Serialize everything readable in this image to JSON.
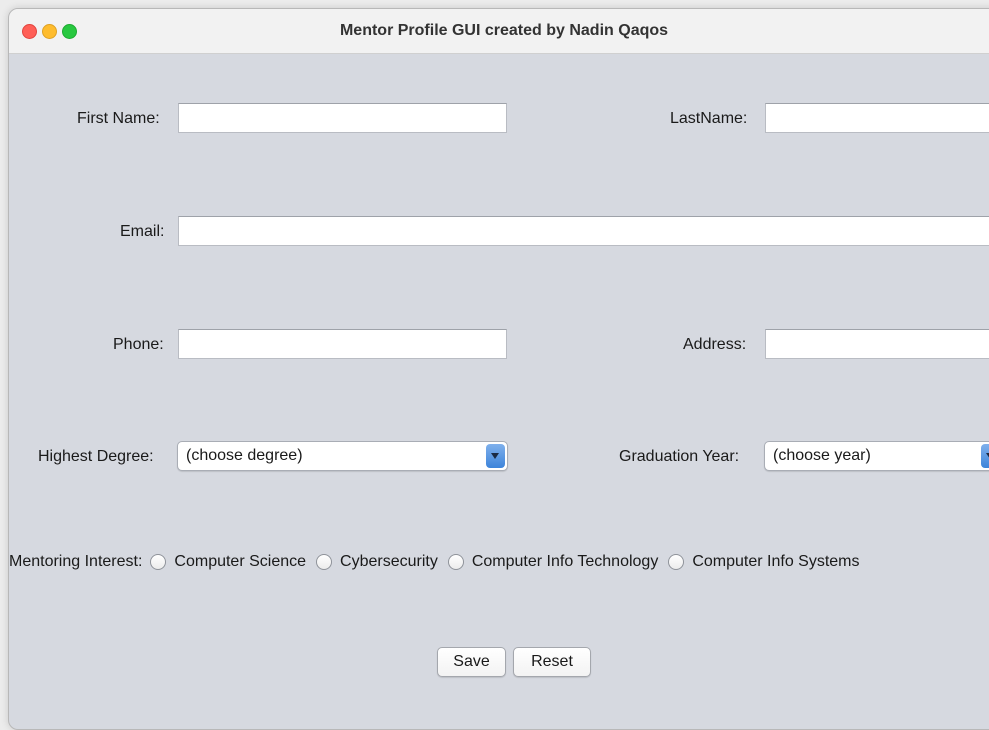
{
  "window": {
    "title": "Mentor Profile GUI created by Nadin Qaqos"
  },
  "form": {
    "first_name": {
      "label": "First Name:",
      "value": ""
    },
    "last_name": {
      "label": "LastName:",
      "value": ""
    },
    "email": {
      "label": "Email:",
      "value": ""
    },
    "phone": {
      "label": "Phone:",
      "value": ""
    },
    "address": {
      "label": "Address:",
      "value": ""
    },
    "highest_degree": {
      "label": "Highest Degree:",
      "selected": "(choose degree)"
    },
    "graduation_year": {
      "label": "Graduation Year:",
      "selected": "(choose year)"
    },
    "mentoring_interest": {
      "label": "Mentoring Interest:",
      "options": [
        "Computer Science",
        "Cybersecurity",
        "Computer Info Technology",
        "Computer Info Systems"
      ]
    }
  },
  "buttons": {
    "save": "Save",
    "reset": "Reset"
  },
  "colors": {
    "window_background": "#d6d9e0",
    "close": "#ff5f57",
    "minimize": "#febc2e",
    "maximize": "#28c840",
    "combo_arrow": "#3d84da"
  }
}
